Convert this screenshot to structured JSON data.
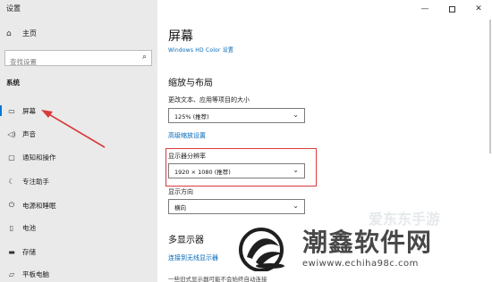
{
  "window": {
    "app_title": "设置",
    "minimize": "—",
    "close": "✕"
  },
  "sidebar": {
    "home_label": "主页",
    "search_placeholder": "查找设置",
    "section_label": "系统",
    "items": [
      {
        "label": "屏幕",
        "icon": "monitor-icon"
      },
      {
        "label": "声音",
        "icon": "speaker-icon"
      },
      {
        "label": "通知和操作",
        "icon": "notification-icon"
      },
      {
        "label": "专注助手",
        "icon": "moon-icon"
      },
      {
        "label": "电源和睡眠",
        "icon": "power-icon"
      },
      {
        "label": "电池",
        "icon": "battery-icon"
      },
      {
        "label": "存储",
        "icon": "storage-icon"
      },
      {
        "label": "平板电脑",
        "icon": "tablet-icon"
      }
    ]
  },
  "main": {
    "title": "屏幕",
    "hdr_link": "Windows HD Color 设置",
    "scale_section": "缩放与布局",
    "scale_label": "更改文本、应用等项目的大小",
    "scale_value": "125% (推荐)",
    "advanced_link": "高级缩放设置",
    "resolution_label": "显示器分辨率",
    "resolution_value": "1920 × 1080 (推荐)",
    "orientation_label": "显示方向",
    "orientation_value": "横向",
    "multi_section": "多显示器",
    "connect_link": "连接到无线显示器",
    "caption": "一些旧式显示器可能不会始终自动连接"
  },
  "watermark": {
    "text": "潮鑫软件网",
    "url": "ewiwww.echiha98c.com",
    "faint": "爱东东手游"
  },
  "colors": {
    "accent": "#0078d7",
    "link": "#0067b8",
    "highlight": "#d93a3a",
    "sidebar_bg": "#eaeaea"
  }
}
